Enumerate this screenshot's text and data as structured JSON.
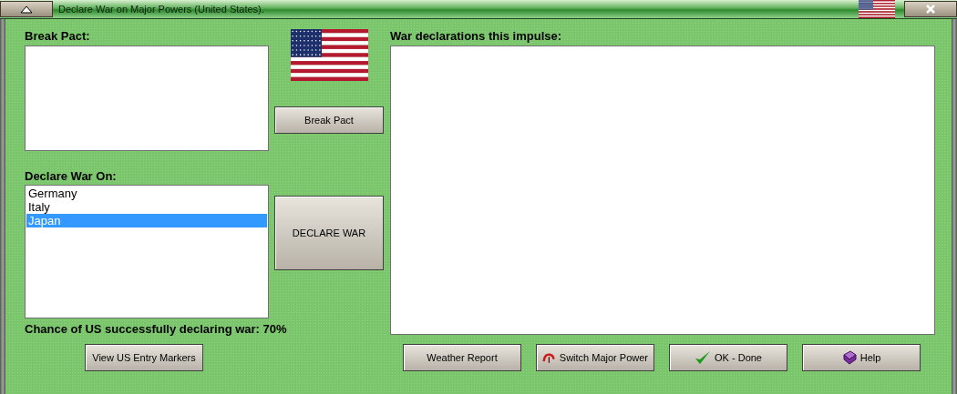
{
  "window": {
    "title": "Declare War on Major Powers (United States)."
  },
  "break_pact": {
    "label": "Break Pact:",
    "button": "Break Pact"
  },
  "declare_war": {
    "label": "Declare War On:",
    "items": [
      {
        "label": "Germany",
        "selected": false
      },
      {
        "label": "Italy",
        "selected": false
      },
      {
        "label": "Japan",
        "selected": true
      }
    ],
    "button": "DECLARE WAR"
  },
  "chance": "Chance of US successfully declaring war: 70%",
  "declarations": {
    "label": "War declarations this impulse:"
  },
  "buttons": [
    {
      "label": "View US Entry Markers",
      "kind": "plain"
    },
    {
      "label": "Weather Report",
      "kind": "plain"
    },
    {
      "label": "Switch Major Power",
      "kind": "switch"
    },
    {
      "label": "OK - Done",
      "kind": "confirm"
    },
    {
      "label": "Help",
      "kind": "help"
    }
  ]
}
